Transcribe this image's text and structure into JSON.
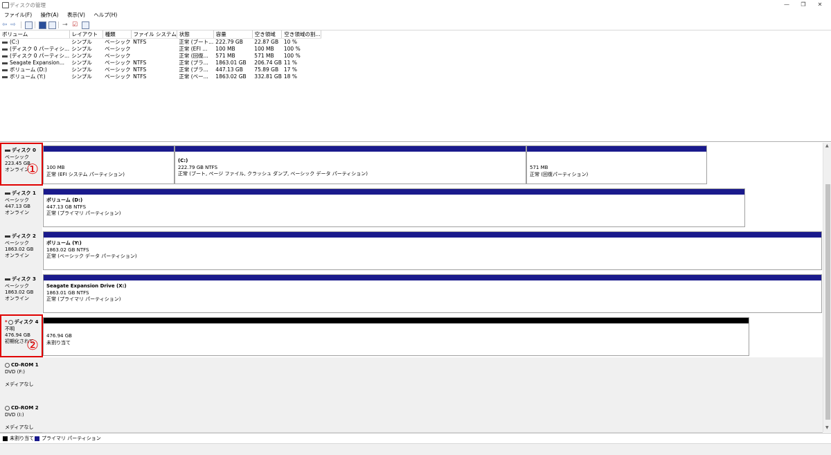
{
  "window": {
    "title": "ディスクの管理"
  },
  "menu": [
    "ファイル(F)",
    "操作(A)",
    "表示(V)",
    "ヘルプ(H)"
  ],
  "columns": [
    "ボリューム",
    "レイアウト",
    "種類",
    "ファイル システム",
    "状態",
    "容量",
    "空き領域",
    "空き領域の割..."
  ],
  "volumes": [
    [
      "(C:)",
      "シンプル",
      "ベーシック",
      "NTFS",
      "正常 (ブート...",
      "222.79 GB",
      "22.87 GB",
      "10 %"
    ],
    [
      "(ディスク 0 パーティシ...",
      "シンプル",
      "ベーシック",
      "",
      "正常 (EFI ...",
      "100 MB",
      "100 MB",
      "100 %"
    ],
    [
      "(ディスク 0 パーティシ...",
      "シンプル",
      "ベーシック",
      "",
      "正常 (回復...",
      "571 MB",
      "571 MB",
      "100 %"
    ],
    [
      "Seagate Expansion...",
      "シンプル",
      "ベーシック",
      "NTFS",
      "正常 (プラ...",
      "1863.01 GB",
      "206.74 GB",
      "11 %"
    ],
    [
      "ボリューム (D:)",
      "シンプル",
      "ベーシック",
      "NTFS",
      "正常 (プラ...",
      "447.13 GB",
      "75.89 GB",
      "17 %"
    ],
    [
      "ボリューム (Y:)",
      "シンプル",
      "ベーシック",
      "NTFS",
      "正常 (ベー...",
      "1863.02 GB",
      "332.81 GB",
      "18 %"
    ]
  ],
  "disks": {
    "d0": {
      "name": "ディスク 0",
      "type": "ベーシック",
      "size": "223.45 GB",
      "status": "オンライン",
      "p1": {
        "l1": "100 MB",
        "l2": "正常 (EFI システム パーティション)"
      },
      "p2": {
        "title": "(C:)",
        "l1": "222.79 GB NTFS",
        "l2": "正常 (ブート, ページ ファイル, クラッシュ ダンプ, ベーシック データ パーティション)"
      },
      "p3": {
        "l1": "571 MB",
        "l2": "正常 (回復パーティション)"
      }
    },
    "d1": {
      "name": "ディスク 1",
      "type": "ベーシック",
      "size": "447.13 GB",
      "status": "オンライン",
      "p1": {
        "title": "ボリューム  (D:)",
        "l1": "447.13 GB NTFS",
        "l2": "正常 (プライマリ パーティション)"
      }
    },
    "d2": {
      "name": "ディスク 2",
      "type": "ベーシック",
      "size": "1863.02 GB",
      "status": "オンライン",
      "p1": {
        "title": "ボリューム  (Y:)",
        "l1": "1863.02 GB NTFS",
        "l2": "正常 (ベーシック データ パーティション)"
      }
    },
    "d3": {
      "name": "ディスク 3",
      "type": "ベーシック",
      "size": "1863.02 GB",
      "status": "オンライン",
      "p1": {
        "title": "Seagate Expansion Drive  (X:)",
        "l1": "1863.01 GB NTFS",
        "l2": "正常 (プライマリ パーティション)"
      }
    },
    "d4": {
      "name": "ディスク 4",
      "type": "不明",
      "size": "476.94 GB",
      "status": "初期化されて",
      "p1": {
        "l1": "476.94 GB",
        "l2": "未割り当て"
      }
    },
    "cd1": {
      "name": "CD-ROM 1",
      "drive": "DVD (F:)",
      "media": "メディアなし"
    },
    "cd2": {
      "name": "CD-ROM 2",
      "drive": "DVD (I:)",
      "media": "メディアなし"
    }
  },
  "markers": {
    "m1": "①",
    "m2": "②"
  },
  "legend": {
    "unallocated": "未割り当て",
    "primary": "プライマリ パーティション"
  },
  "colors": {
    "primary": "#1a1a8c",
    "unallocated": "#000000",
    "highlight": "#e00000"
  }
}
